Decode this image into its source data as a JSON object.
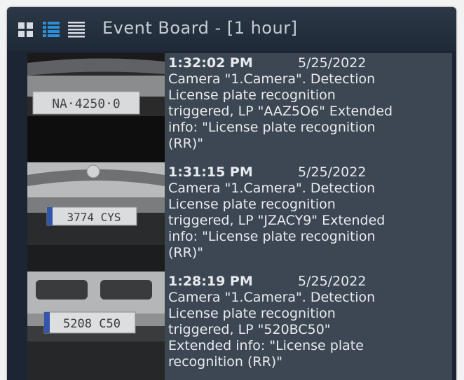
{
  "header": {
    "title": "Event Board - [1 hour]",
    "icons": [
      "grid-view-icon",
      "list-view-icon",
      "compact-view-icon"
    ],
    "active_icon_color": "#2d8fd8"
  },
  "events": [
    {
      "time": "1:32:02 PM",
      "date": "5/25/2022",
      "description": "Camera \"1.Camera\". Detection\nLicense plate recognition\ntriggered, LP \"AAZ5O6\" Extended\ninfo: \"License plate recognition\n(RR)\"",
      "plate_text": "NA·4250·0"
    },
    {
      "time": "1:31:15 PM",
      "date": "5/25/2022",
      "description": "Camera \"1.Camera\". Detection\nLicense plate recognition\ntriggered, LP \"JZACY9\" Extended\ninfo: \"License plate recognition\n(RR)\"",
      "plate_text": "3774 CYS"
    },
    {
      "time": "1:28:19 PM",
      "date": "5/25/2022",
      "description": "Camera \"1.Camera\". Detection\nLicense plate recognition\ntriggered, LP \"520BC50\"\nExtended info: \"License plate\nrecognition (RR)\"",
      "plate_text": "5208 C50"
    }
  ]
}
